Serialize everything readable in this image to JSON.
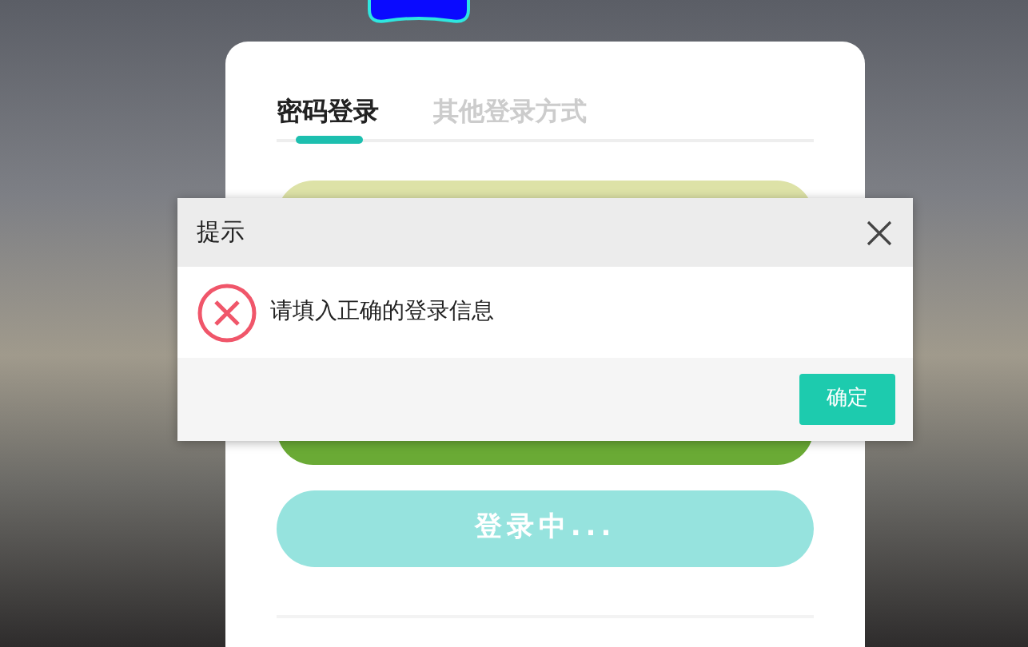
{
  "tabs": [
    {
      "label": "密码登录",
      "selected": true
    },
    {
      "label": "其他登录方式",
      "selected": false
    }
  ],
  "login_button": {
    "label": "登录中..."
  },
  "dialog": {
    "title": "提示",
    "message": "请填入正确的登录信息",
    "kind": "error",
    "buttons": [
      "确定"
    ]
  }
}
